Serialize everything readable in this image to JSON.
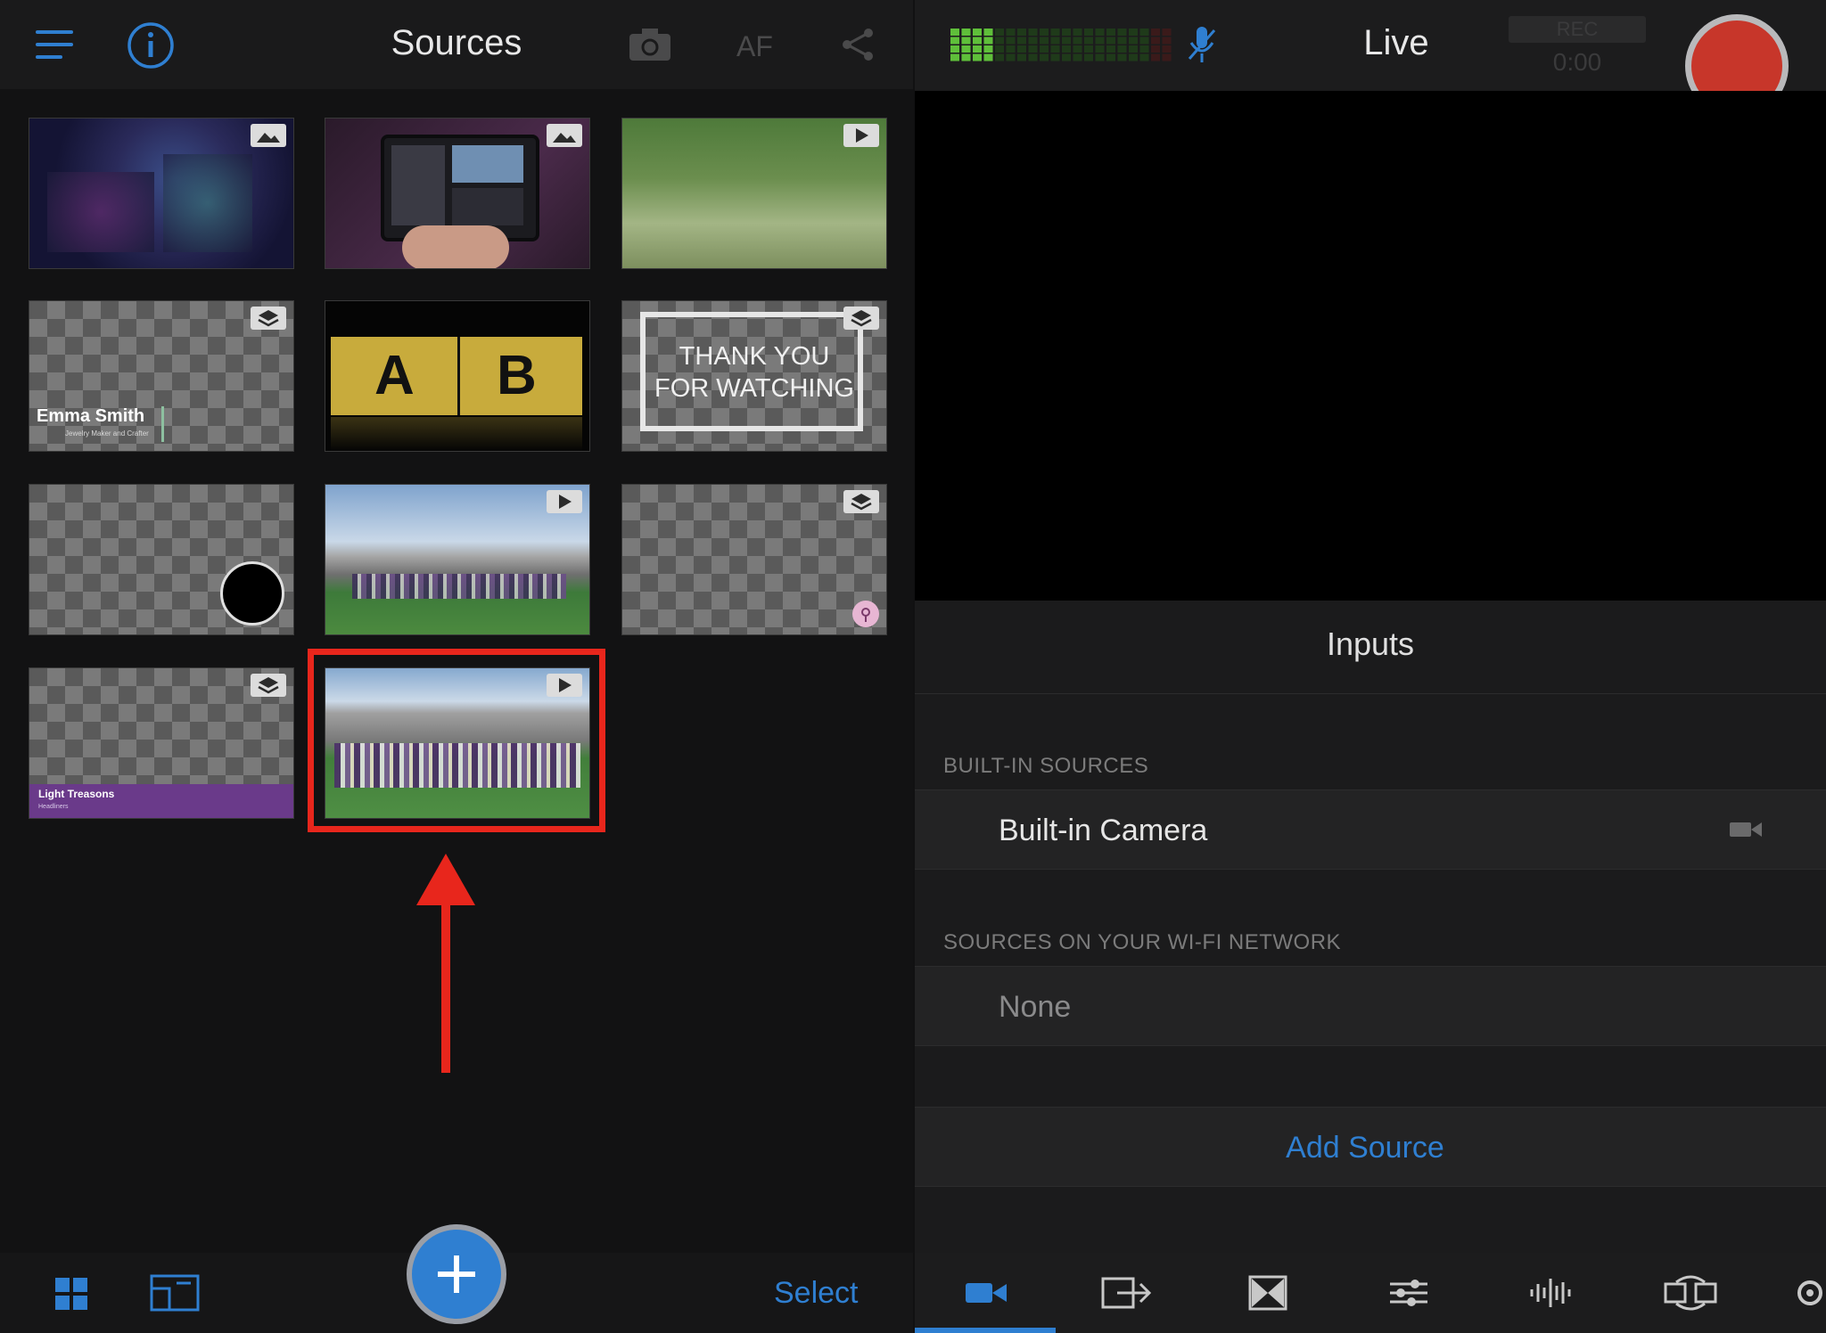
{
  "sources_pane": {
    "title": "Sources",
    "header_icons": [
      "menu-icon",
      "info-icon",
      "camera-flip-icon",
      "share-icon"
    ],
    "af_label": "AF",
    "thumbnails": [
      {
        "kind": "image",
        "badge": "image-icon",
        "desc_text": ""
      },
      {
        "kind": "image",
        "badge": "image-icon",
        "desc_text": ""
      },
      {
        "kind": "video",
        "badge": "play-icon",
        "desc_text": ""
      },
      {
        "kind": "overlay",
        "badge": "layers-icon",
        "title_text": "Emma Smith",
        "subtitle_text": "Jewelry Maker and Crafter"
      },
      {
        "kind": "overlay",
        "badge": "",
        "left_letter": "A",
        "right_letter": "B"
      },
      {
        "kind": "overlay",
        "badge": "layers-icon",
        "line1": "THANK YOU",
        "line2": "FOR WATCHING"
      },
      {
        "kind": "overlay",
        "badge": "",
        "desc_text": ""
      },
      {
        "kind": "video",
        "badge": "play-icon",
        "desc_text": ""
      },
      {
        "kind": "overlay",
        "badge": "layers-icon",
        "desc_text": ""
      },
      {
        "kind": "overlay",
        "badge": "layers-icon",
        "title_text": "Light Treasons",
        "subtitle_text": "Headliners"
      },
      {
        "kind": "video",
        "badge": "play-icon",
        "desc_text": "",
        "selected": true
      }
    ],
    "footer": {
      "select_label": "Select",
      "add_label": "+"
    }
  },
  "live_pane": {
    "title": "Live",
    "rec_label": "REC",
    "rec_time": "0:00",
    "inputs_title": "Inputs",
    "built_in_header": "BUILT-IN SOURCES",
    "built_in_items": [
      "Built-in Camera"
    ],
    "wifi_header": "SOURCES ON YOUR WI-FI NETWORK",
    "wifi_items": [
      "None"
    ],
    "add_source_label": "Add Source",
    "bottom_tabs": [
      "camera-tab-icon",
      "output-tab-icon",
      "transition-tab-icon",
      "sliders-tab-icon",
      "audio-tab-icon",
      "switch-tab-icon",
      "settings-tab-icon"
    ]
  },
  "annotation": {
    "highlight_color": "#e8261c"
  },
  "colors": {
    "accent_blue": "#2f7fd1",
    "record_red": "#c7362a"
  }
}
